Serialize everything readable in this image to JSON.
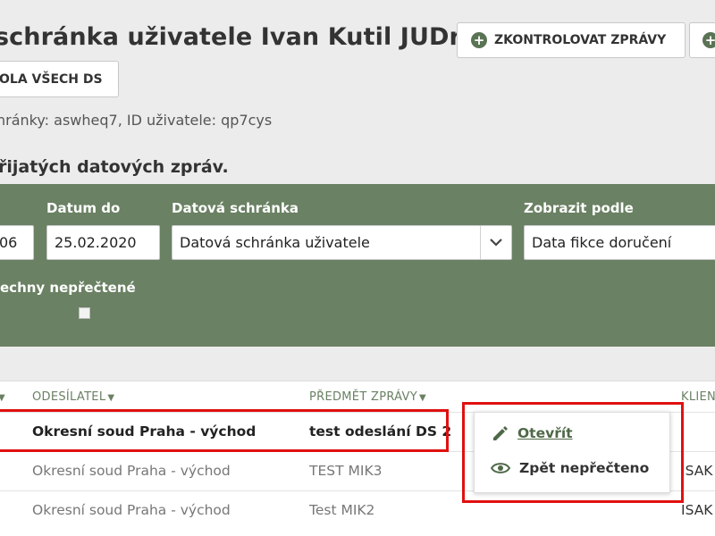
{
  "header": {
    "title": "schránka uživatele Ivan Kutil JUDr.",
    "check_button": "ZKONTROLOVAT ZPRÁVY",
    "all_button": "OLA VŠECH DS",
    "info": "hránky: aswheq7, ID uživatele: qp7cys",
    "section_title": "řijatých datových zpráv."
  },
  "filters": {
    "date_from_value": "06",
    "date_to_label": "Datum do",
    "date_to_value": "25.02.2020",
    "box_label": "Datová schránka",
    "box_value": "Datová schránka uživatele",
    "show_by_label": "Zobrazit podle",
    "show_by_value": "Data fikce doručení",
    "unread_label": "echny nepřečtené"
  },
  "table": {
    "columns": [
      "ODESÍLATEL",
      "PŘEDMĚT ZPRÁVY",
      "KLIEN"
    ],
    "rows": [
      {
        "sender": "Okresní soud Praha - východ",
        "subject": "test odeslání DS 2",
        "client": "",
        "unread": true
      },
      {
        "sender": "Okresní soud Praha - východ",
        "subject": "TEST MIK3",
        "client": "ISAK",
        "unread": false
      },
      {
        "sender": "Okresní soud Praha - východ",
        "subject": "Test MIK2",
        "client": "ISAK",
        "unread": false
      }
    ]
  },
  "context_menu": {
    "open": "Otevřít",
    "mark_unread": "Zpět nepřečteno"
  },
  "colors": {
    "accent_green": "#6a8163",
    "highlight_red": "#e01010"
  }
}
